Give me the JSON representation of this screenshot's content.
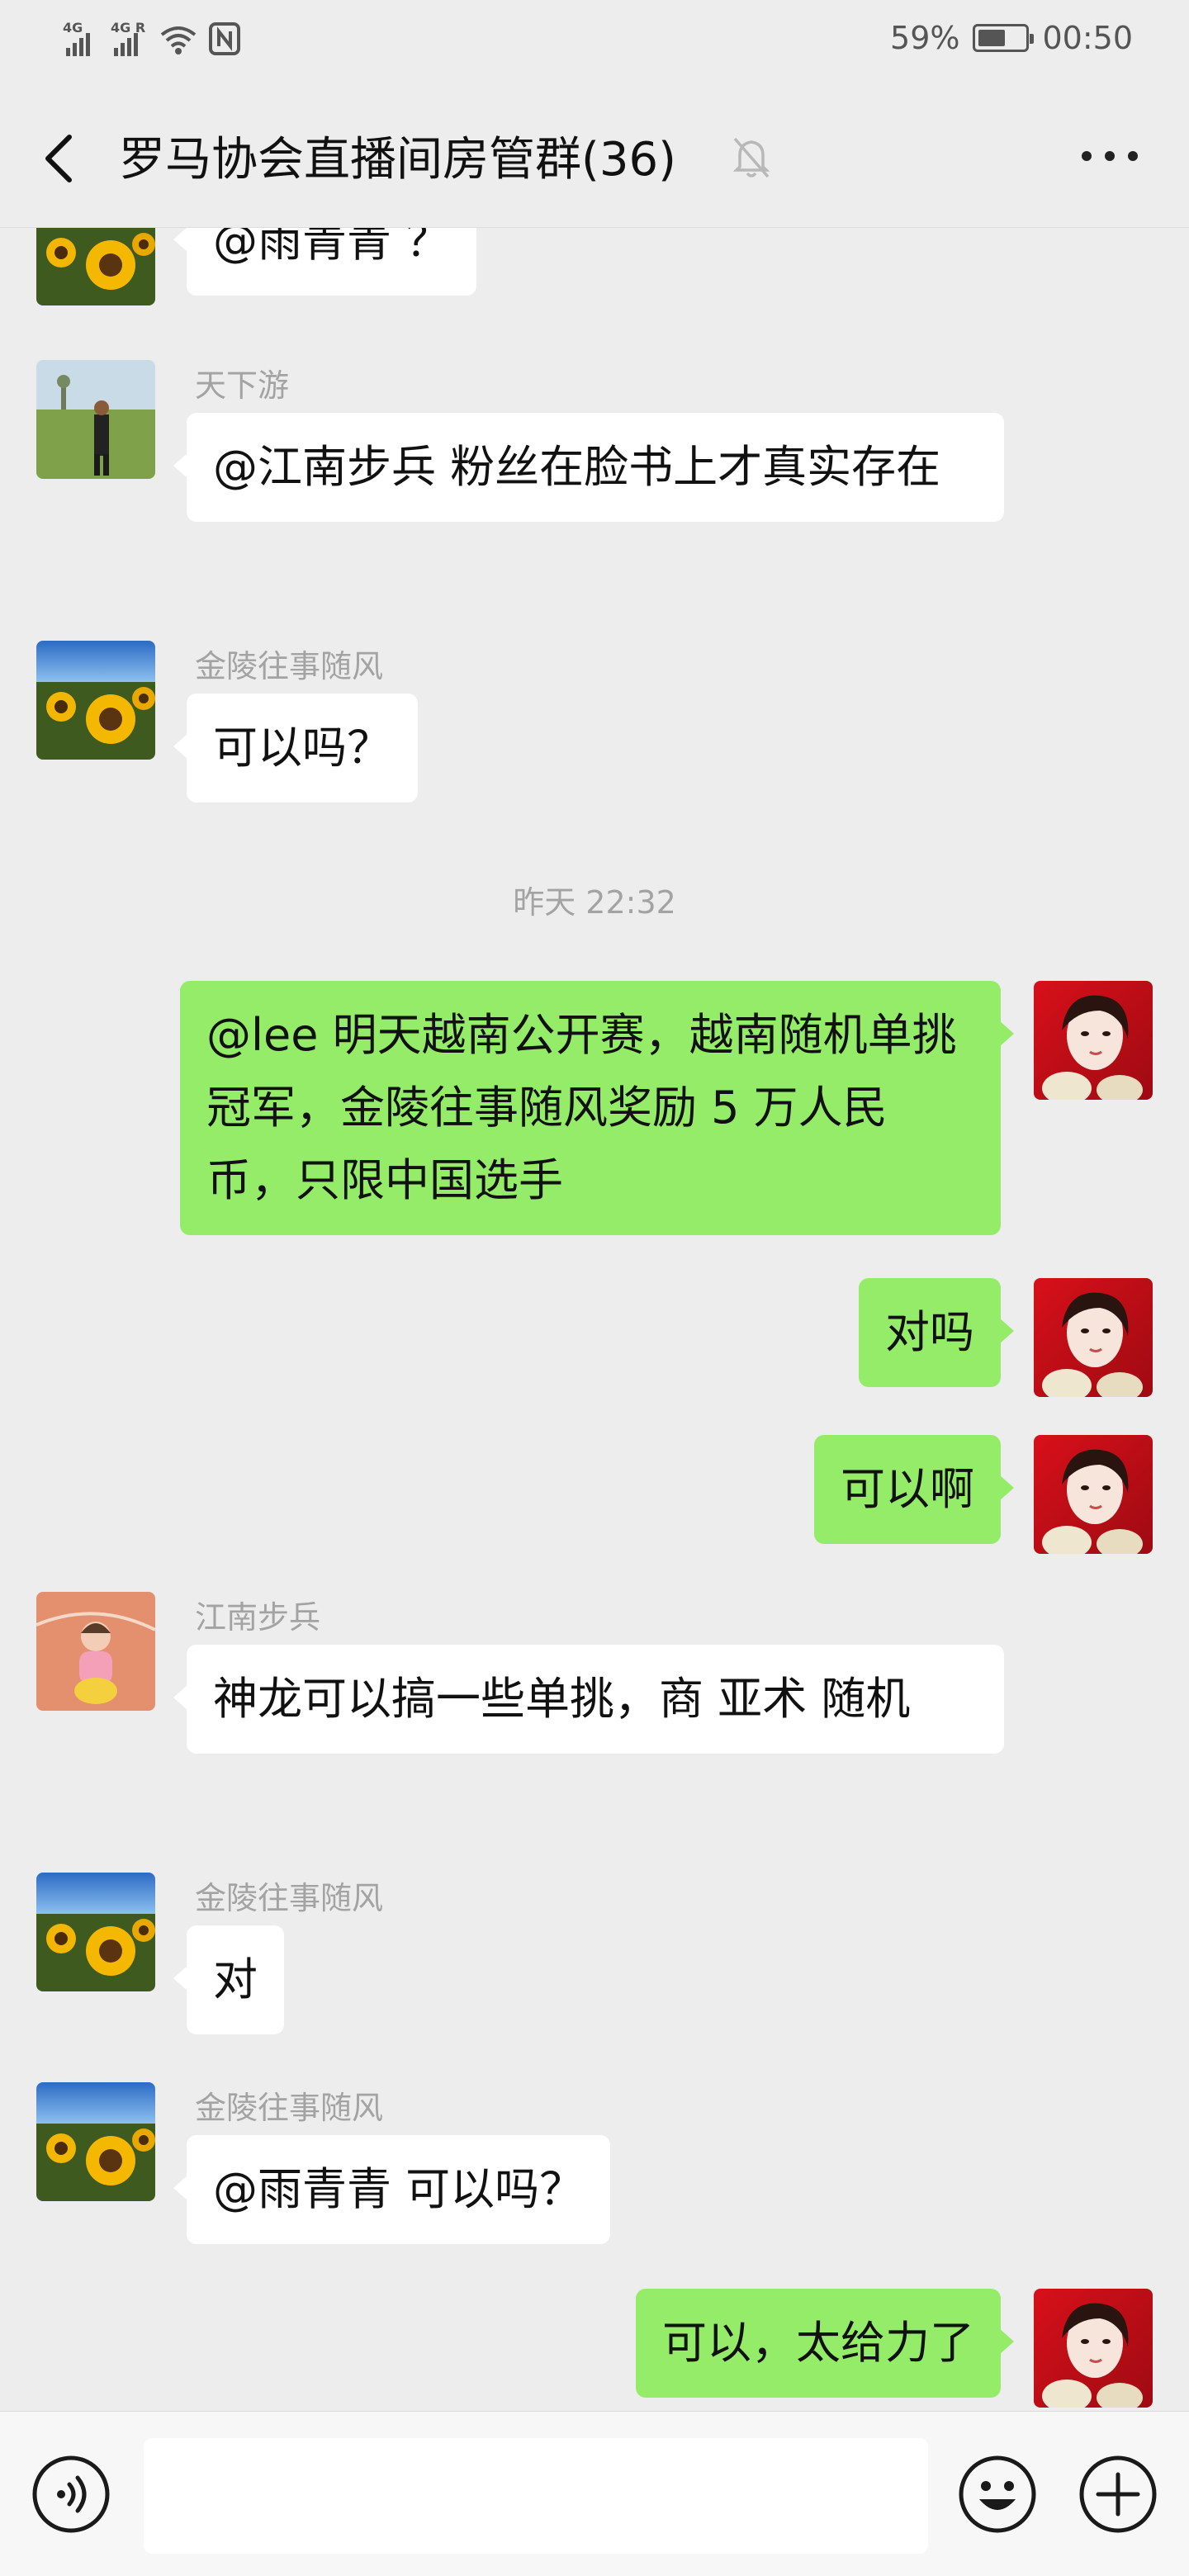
{
  "status_bar": {
    "sim1_label": "4G",
    "sim2_label": "4G R",
    "battery_text": "59%",
    "battery_level": 0.59,
    "time": "00:50"
  },
  "nav": {
    "title": "罗马协会直播间房管群(36)",
    "icons": [
      "back-arrow-icon",
      "muted-bell-icon",
      "more-dots-icon"
    ]
  },
  "messages": [
    {
      "id": "m1",
      "direction": "in",
      "sender": "",
      "text": "@雨青青 ？"
    },
    {
      "id": "m2",
      "direction": "in",
      "sender": "天下游",
      "text": "@江南步兵  粉丝在脸书上才真实存在"
    },
    {
      "id": "m3",
      "direction": "in",
      "sender": "金陵往事随风",
      "text": "可以吗？"
    },
    {
      "id": "m4",
      "direction": "out",
      "sender": "",
      "text": "@lee 明天越南公开赛，越南随机单挑冠军，金陵往事随风奖励 5 万人民币，只限中国选手"
    },
    {
      "id": "m5",
      "direction": "out",
      "sender": "",
      "text": "对吗"
    },
    {
      "id": "m6",
      "direction": "out",
      "sender": "",
      "text": "可以啊"
    },
    {
      "id": "m7",
      "direction": "in",
      "sender": "江南步兵",
      "text": "神龙可以搞一些单挑，商  亚术  随机"
    },
    {
      "id": "m8",
      "direction": "in",
      "sender": "金陵往事随风",
      "text": "对"
    },
    {
      "id": "m9",
      "direction": "in",
      "sender": "金陵往事随风",
      "text": "@雨青青  可以吗？"
    },
    {
      "id": "m10",
      "direction": "out",
      "sender": "",
      "text": "可以，太给力了"
    }
  ],
  "timestamp": "昨天 22:32",
  "input_bar": {
    "input_value": "",
    "icons": [
      "voice-icon",
      "emoji-icon",
      "plus-icon"
    ]
  },
  "colors": {
    "background": "#ededed",
    "incoming_bubble": "#ffffff",
    "outgoing_bubble": "#95ec69",
    "meta_text": "#a3a3a3"
  }
}
